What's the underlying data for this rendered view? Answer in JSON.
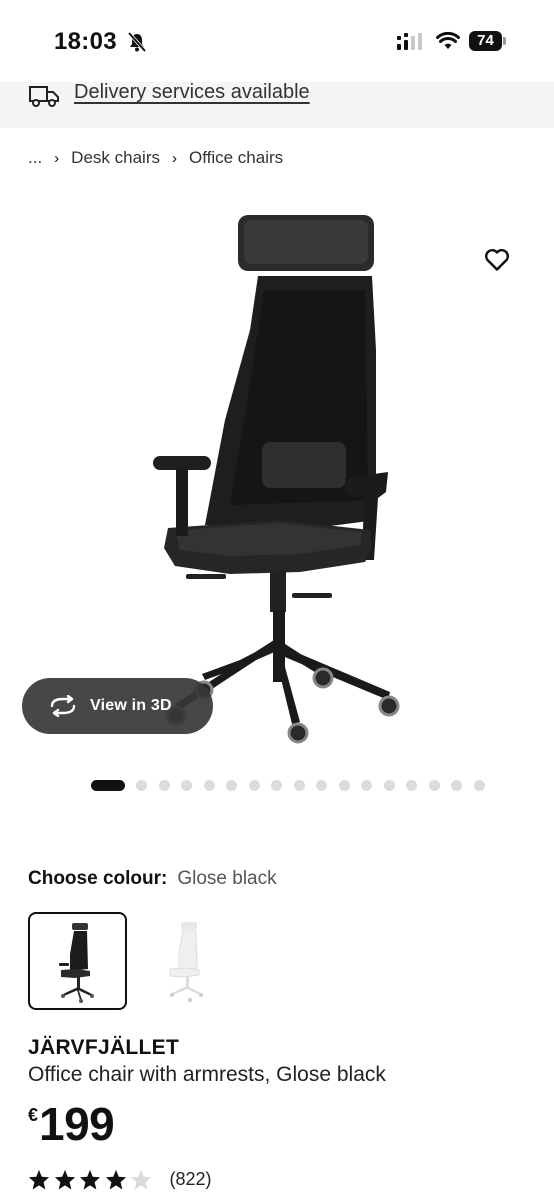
{
  "status_bar": {
    "time": "18:03",
    "battery": "74"
  },
  "delivery": {
    "label": "Delivery services available"
  },
  "breadcrumb": {
    "ellipsis": "...",
    "items": [
      "Desk chairs",
      "Office chairs"
    ]
  },
  "gallery": {
    "view3d_label": "View in 3D",
    "total_images": 17,
    "active_index": 0
  },
  "colour": {
    "label": "Choose colour:",
    "selected": "Glose black"
  },
  "product": {
    "name": "JÄRVFJÄLLET",
    "description": "Office chair with armrests, Glose black",
    "currency": "€",
    "price": "199",
    "rating": 4,
    "rating_max": 5,
    "review_count": "(822)"
  },
  "icons": {
    "bell": "bell-slash-icon",
    "signal": "cellular-signal-icon",
    "wifi": "wifi-icon",
    "truck": "delivery-truck-icon",
    "heart": "heart-outline-icon",
    "rotate": "rotate-3d-icon",
    "star": "star-icon"
  }
}
